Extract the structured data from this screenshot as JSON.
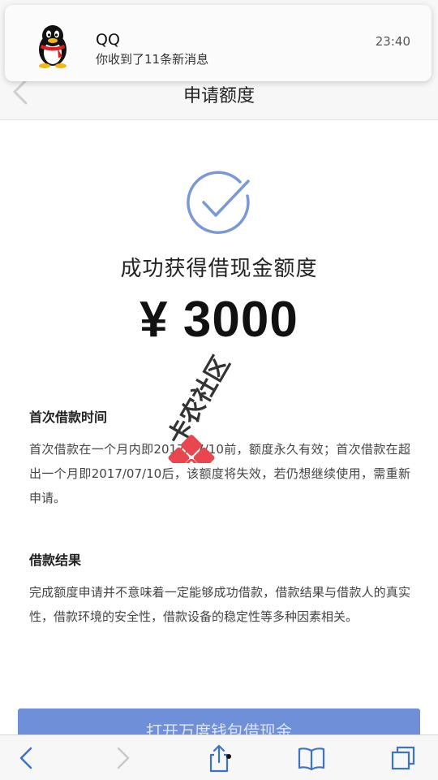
{
  "notification": {
    "app_name": "QQ",
    "message": "你收到了11条新消息",
    "time": "23:40",
    "icon": "qq-penguin-icon"
  },
  "nav": {
    "title": "申请额度",
    "back_icon": "chevron-left-icon"
  },
  "result": {
    "icon": "check-circle-icon",
    "title": "成功获得借现金额度",
    "amount": "¥ 3000"
  },
  "sections": [
    {
      "title": "首次借款时间",
      "body": "首次借款在一个月内即2017/07/10前，额度永久有效；首次借款在超出一个月即2017/07/10后，该额度将失效，若仍想继续使用，需重新申请。"
    },
    {
      "title": "借款结果",
      "body": "完成额度申请并不意味着一定能够成功借款，借款结果与借款人的真实性，借款环境的安全性，借款设备的稳定性等多种因素相关。"
    }
  ],
  "watermark": {
    "text": "卡农社区"
  },
  "action": {
    "label": "打开万度钱包借现金"
  },
  "toolbar": {
    "items": [
      "back-icon",
      "forward-icon",
      "share-icon",
      "bookmarks-icon",
      "tabs-icon"
    ]
  },
  "colors": {
    "accent": "#6f8fd8",
    "check": "#7a97d6",
    "toolbar_icon": "#3d73c7"
  }
}
